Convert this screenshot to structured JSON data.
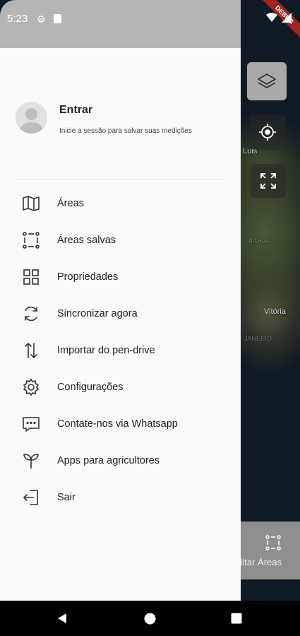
{
  "status_bar": {
    "time": "5:23"
  },
  "debug_banner": "DEBUG",
  "map": {
    "labels": [
      "Luis",
      "Vitória",
      "BAHIA",
      "JANEIRO"
    ]
  },
  "bottom_action": {
    "label": "ditar Áreas"
  },
  "profile": {
    "title": "Entrar",
    "subtitle": "Inicie a sessão para salvar suas medições"
  },
  "menu": [
    {
      "label": "Áreas",
      "icon": "map-icon"
    },
    {
      "label": "Áreas salvas",
      "icon": "dashed-square-icon"
    },
    {
      "label": "Propriedades",
      "icon": "grid-icon"
    },
    {
      "label": "Sincronizar agora",
      "icon": "sync-icon"
    },
    {
      "label": "Importar do pen-drive",
      "icon": "import-arrows-icon"
    },
    {
      "label": "Configurações",
      "icon": "gear-icon"
    },
    {
      "label": "Contate-nos via Whatsapp",
      "icon": "chat-icon"
    },
    {
      "label": "Apps para agricultores",
      "icon": "sprout-icon"
    },
    {
      "label": "Sair",
      "icon": "logout-icon"
    }
  ],
  "colors": {
    "drawer_bg": "#fafafa",
    "status_bar_bg": "#b5b5b5",
    "text": "#212121"
  }
}
